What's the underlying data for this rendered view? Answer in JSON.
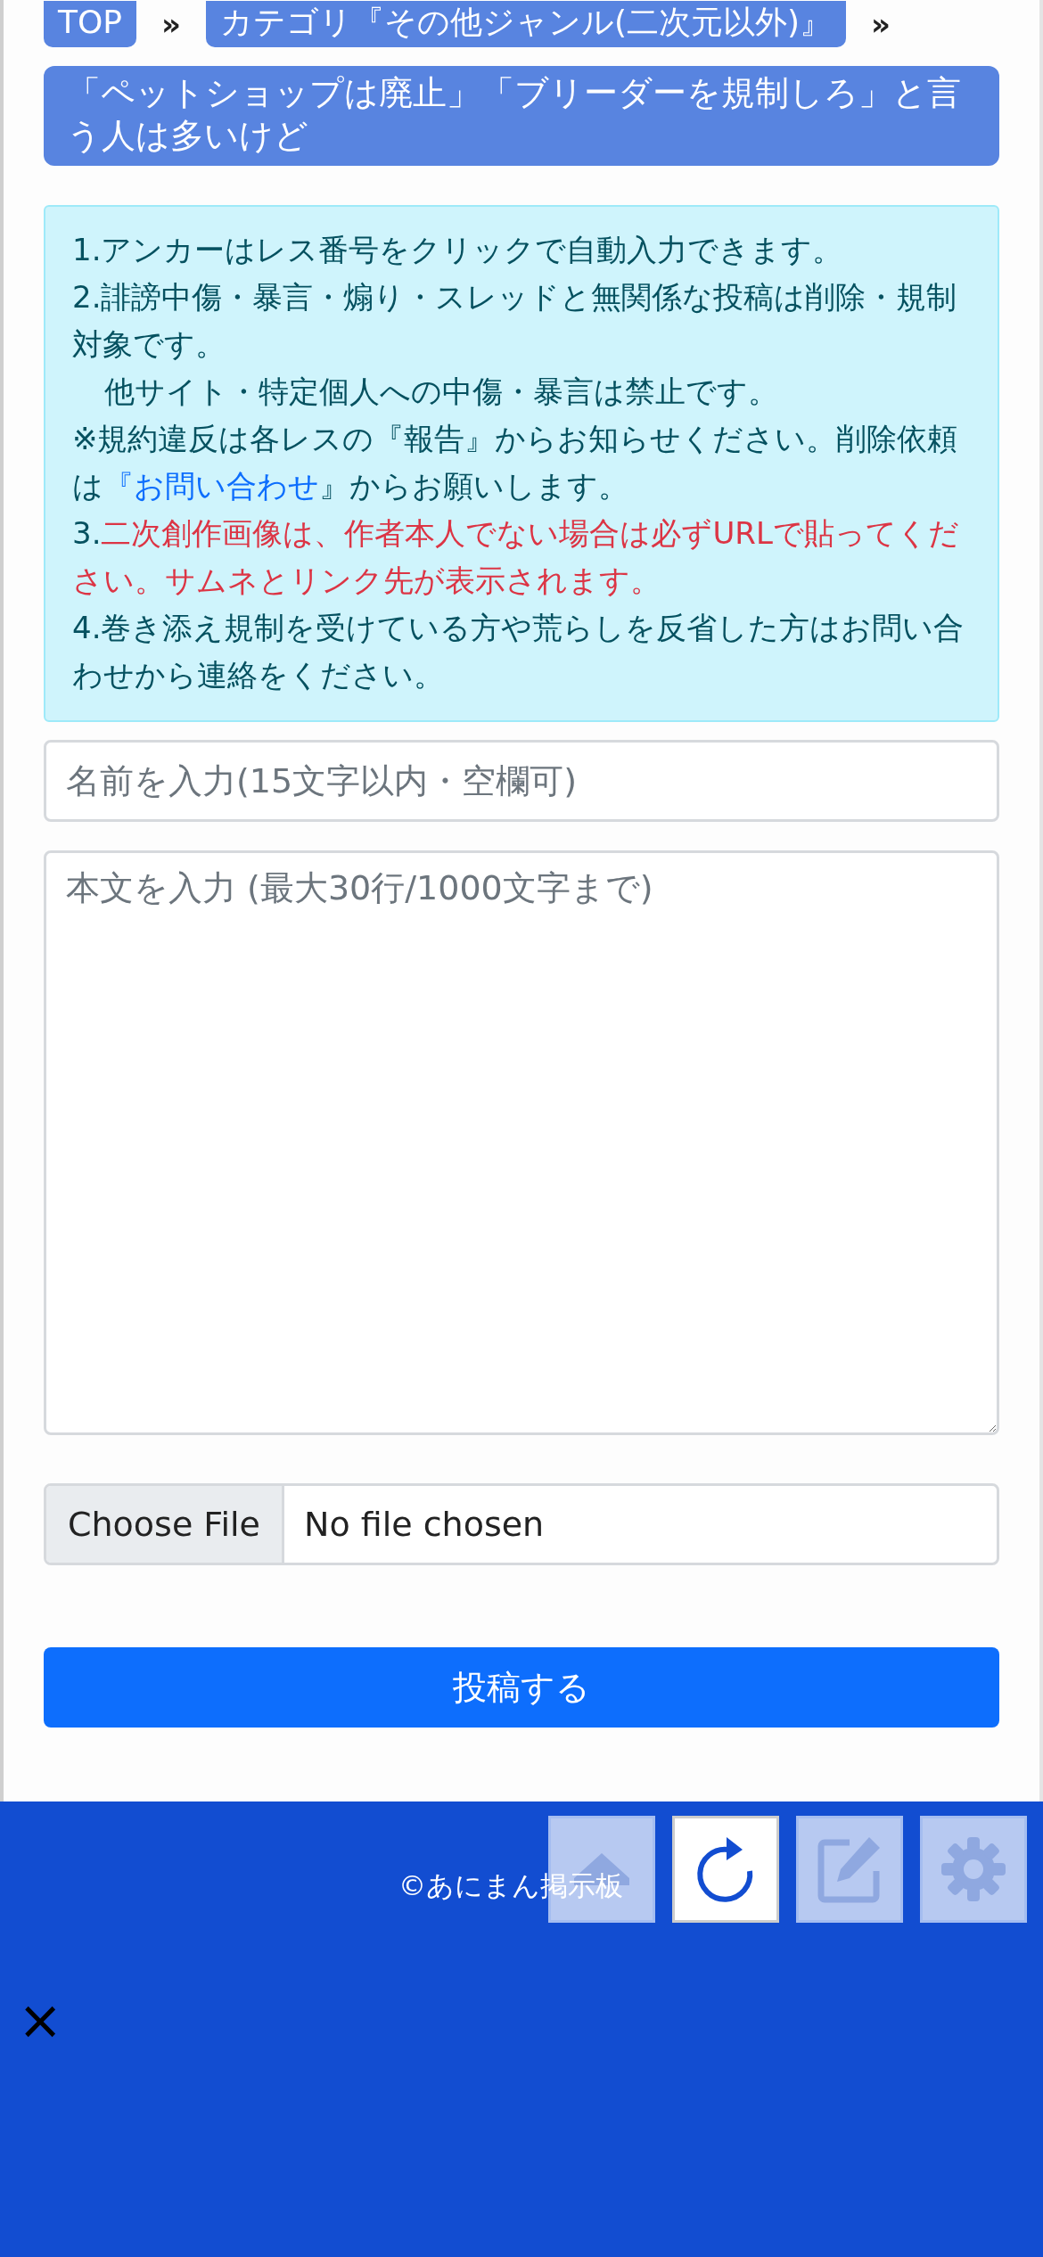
{
  "breadcrumb": [
    {
      "label": "TOP",
      "separator": "»"
    },
    {
      "label": "カテゴリ『その他ジャンル(二次元以外)』",
      "separator": "»"
    }
  ],
  "thread_title": "「ペットショップは廃止」「ブリーダーを規制しろ」と言う人は多いけど",
  "notice": {
    "paragraphs": [
      {
        "indent": false,
        "segments": [
          {
            "kind": "plain",
            "text": "1.アンカーはレス番号をクリックで自動入力できます。"
          }
        ]
      },
      {
        "indent": false,
        "segments": [
          {
            "kind": "plain",
            "text": "2.誹謗中傷・暴言・煽り・スレッドと無関係な投稿は削除・規制対象です。"
          }
        ]
      },
      {
        "indent": true,
        "segments": [
          {
            "kind": "plain",
            "text": "他サイト・特定個人への中傷・暴言は禁止です。"
          }
        ]
      },
      {
        "indent": false,
        "segments": [
          {
            "kind": "plain",
            "text": "※規約違反は各レスの『報告』からお知らせください。削除依頼は"
          },
          {
            "kind": "link",
            "text": "『お問い合わせ"
          },
          {
            "kind": "plain",
            "text": "』からお願いします。"
          }
        ]
      },
      {
        "indent": false,
        "segments": [
          {
            "kind": "plain",
            "text": "3."
          },
          {
            "kind": "alert",
            "text": "二次創作画像は、作者本人でない場合は必ずURLで貼ってください。サムネとリンク先が表示されます。"
          }
        ]
      },
      {
        "indent": false,
        "segments": [
          {
            "kind": "plain",
            "text": "4.巻き添え規制を受けている方や荒らしを反省した方はお問い合わせから連絡をください。"
          }
        ]
      }
    ]
  },
  "form": {
    "name_placeholder": "名前を入力(15文字以内・空欄可)",
    "body_placeholder": "本文を入力 (最大30行/1000文字まで)",
    "file_button": "Choose File",
    "file_status": "No file chosen",
    "submit": "投稿する"
  },
  "footer": {
    "copyright": "©あにまん掲示板",
    "close": "×"
  },
  "floating_buttons": [
    {
      "kind": "upload",
      "active": false
    },
    {
      "kind": "reload",
      "active": true
    },
    {
      "kind": "edit",
      "active": false
    },
    {
      "kind": "settings",
      "active": false
    }
  ]
}
